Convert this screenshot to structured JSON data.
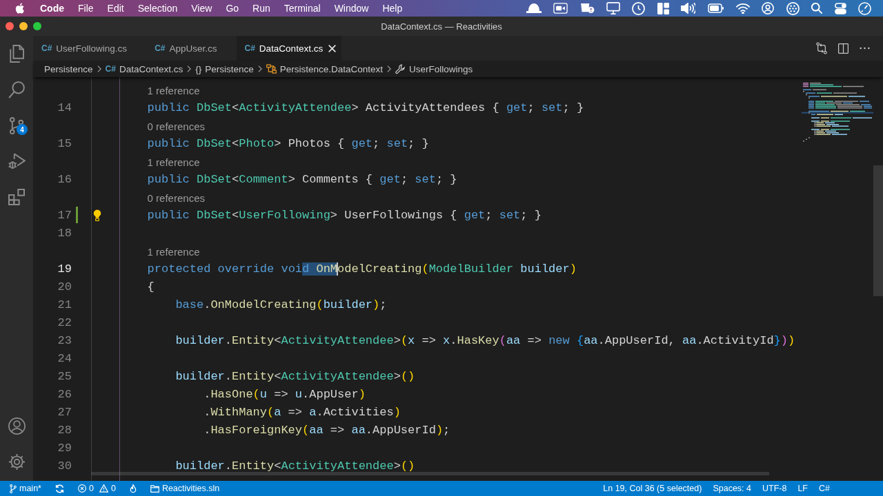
{
  "menu_bar": {
    "app_name": "Code",
    "items": [
      "File",
      "Edit",
      "Selection",
      "View",
      "Go",
      "Run",
      "Terminal",
      "Window",
      "Help"
    ]
  },
  "window": {
    "title": "DataContext.cs — Reactivities"
  },
  "activity_bar": {
    "badge": "4"
  },
  "tabs": [
    {
      "file_icon": "C#",
      "label": "UserFollowing.cs",
      "selected": false
    },
    {
      "file_icon": "C#",
      "label": "AppUser.cs",
      "selected": false
    },
    {
      "file_icon": "C#",
      "label": "DataContext.cs",
      "selected": true
    }
  ],
  "breadcrumb": [
    {
      "kind": "folder",
      "label": "Persistence"
    },
    {
      "kind": "file",
      "icon_text": "C#",
      "label": "DataContext.cs"
    },
    {
      "kind": "namespace",
      "icon_text": "{}",
      "label": "Persistence"
    },
    {
      "kind": "class",
      "label": "Persistence.DataContext"
    },
    {
      "kind": "property",
      "label": "UserFollowings"
    }
  ],
  "editor": {
    "lines": [
      {
        "number": "14",
        "code_lens": "1 reference",
        "current": false,
        "added": false,
        "lightbulb": false,
        "tokens": [
          {
            "text": "        public ",
            "kind": "keyword"
          },
          {
            "text": "DbSet",
            "kind": "type"
          },
          {
            "text": "<",
            "kind": "plain"
          },
          {
            "text": "ActivityAttendee",
            "kind": "type"
          },
          {
            "text": "> ActivityAttendees { ",
            "kind": "plain"
          },
          {
            "text": "get",
            "kind": "keyword"
          },
          {
            "text": "; ",
            "kind": "plain"
          },
          {
            "text": "set",
            "kind": "keyword"
          },
          {
            "text": "; }",
            "kind": "plain"
          }
        ]
      },
      {
        "number": "15",
        "code_lens": "0 references",
        "current": false,
        "added": false,
        "lightbulb": false,
        "tokens": [
          {
            "text": "        public ",
            "kind": "keyword"
          },
          {
            "text": "DbSet",
            "kind": "type"
          },
          {
            "text": "<",
            "kind": "plain"
          },
          {
            "text": "Photo",
            "kind": "type"
          },
          {
            "text": "> Photos { ",
            "kind": "plain"
          },
          {
            "text": "get",
            "kind": "keyword"
          },
          {
            "text": "; ",
            "kind": "plain"
          },
          {
            "text": "set",
            "kind": "keyword"
          },
          {
            "text": "; }",
            "kind": "plain"
          }
        ]
      },
      {
        "number": "16",
        "code_lens": "1 reference",
        "current": false,
        "added": false,
        "lightbulb": false,
        "tokens": [
          {
            "text": "        public ",
            "kind": "keyword"
          },
          {
            "text": "DbSet",
            "kind": "type"
          },
          {
            "text": "<",
            "kind": "plain"
          },
          {
            "text": "Comment",
            "kind": "type"
          },
          {
            "text": "> Comments { ",
            "kind": "plain"
          },
          {
            "text": "get",
            "kind": "keyword"
          },
          {
            "text": "; ",
            "kind": "plain"
          },
          {
            "text": "set",
            "kind": "keyword"
          },
          {
            "text": "; }",
            "kind": "plain"
          }
        ]
      },
      {
        "number": "17",
        "code_lens": "0 references",
        "current": false,
        "added": true,
        "lightbulb": true,
        "tokens": [
          {
            "text": "        public ",
            "kind": "keyword"
          },
          {
            "text": "DbSet",
            "kind": "type"
          },
          {
            "text": "<",
            "kind": "plain"
          },
          {
            "text": "UserFollowing",
            "kind": "type"
          },
          {
            "text": "> UserFollowings { ",
            "kind": "plain"
          },
          {
            "text": "get",
            "kind": "keyword"
          },
          {
            "text": "; ",
            "kind": "plain"
          },
          {
            "text": "set",
            "kind": "keyword"
          },
          {
            "text": "; }",
            "kind": "plain"
          }
        ]
      },
      {
        "number": "18",
        "current": false,
        "added": false,
        "lightbulb": false
      },
      {
        "number": "19",
        "code_lens": "1 reference",
        "current": true,
        "added": false,
        "lightbulb": false,
        "tokens": [
          {
            "text": "        protected override voi",
            "kind": "keyword",
            "selected": false
          },
          {
            "text": "d ",
            "kind": "keyword",
            "selected": true
          },
          {
            "text": "OnM",
            "kind": "method",
            "selected": true
          },
          {
            "text": "odelCreating",
            "kind": "method",
            "selected": false
          },
          {
            "text": "(",
            "kind": "bracket1",
            "selected": false
          },
          {
            "text": "ModelBuilder",
            "kind": "type",
            "selected": false
          },
          {
            "text": " builder",
            "kind": "variable",
            "selected": false
          },
          {
            "text": ")",
            "kind": "bracket1",
            "selected": false
          }
        ]
      },
      {
        "number": "20",
        "current": false,
        "added": false,
        "lightbulb": false,
        "tokens": [
          {
            "text": "        {",
            "kind": "plain"
          }
        ]
      },
      {
        "number": "21",
        "current": false,
        "added": false,
        "lightbulb": false,
        "tokens": [
          {
            "text": "            base",
            "kind": "keyword"
          },
          {
            "text": ".",
            "kind": "plain"
          },
          {
            "text": "OnModelCreating",
            "kind": "method"
          },
          {
            "text": "(",
            "kind": "bracket1"
          },
          {
            "text": "builder",
            "kind": "variable"
          },
          {
            "text": ")",
            "kind": "bracket1"
          },
          {
            "text": ";",
            "kind": "plain"
          }
        ]
      },
      {
        "number": "22",
        "current": false,
        "added": false,
        "lightbulb": false
      },
      {
        "number": "23",
        "current": false,
        "added": false,
        "lightbulb": false,
        "tokens": [
          {
            "text": "            builder",
            "kind": "variable"
          },
          {
            "text": ".",
            "kind": "plain"
          },
          {
            "text": "Entity",
            "kind": "method"
          },
          {
            "text": "<",
            "kind": "plain"
          },
          {
            "text": "ActivityAttendee",
            "kind": "type"
          },
          {
            "text": ">",
            "kind": "plain"
          },
          {
            "text": "(",
            "kind": "bracket1"
          },
          {
            "text": "x",
            "kind": "variable"
          },
          {
            "text": " => ",
            "kind": "plain"
          },
          {
            "text": "x",
            "kind": "variable"
          },
          {
            "text": ".",
            "kind": "plain"
          },
          {
            "text": "HasKey",
            "kind": "method"
          },
          {
            "text": "(",
            "kind": "bracket2"
          },
          {
            "text": "aa",
            "kind": "variable"
          },
          {
            "text": " => ",
            "kind": "plain"
          },
          {
            "text": "new ",
            "kind": "keyword"
          },
          {
            "text": "{",
            "kind": "bracket3"
          },
          {
            "text": "aa",
            "kind": "variable"
          },
          {
            "text": ".AppUserId, ",
            "kind": "plain"
          },
          {
            "text": "aa",
            "kind": "variable"
          },
          {
            "text": ".ActivityId",
            "kind": "plain"
          },
          {
            "text": "}",
            "kind": "bracket3"
          },
          {
            "text": ")",
            "kind": "bracket2"
          },
          {
            "text": ")",
            "kind": "bracket1"
          }
        ]
      },
      {
        "number": "24",
        "current": false,
        "added": false,
        "lightbulb": false
      },
      {
        "number": "25",
        "current": false,
        "added": false,
        "lightbulb": false,
        "tokens": [
          {
            "text": "            builder",
            "kind": "variable"
          },
          {
            "text": ".",
            "kind": "plain"
          },
          {
            "text": "Entity",
            "kind": "method"
          },
          {
            "text": "<",
            "kind": "plain"
          },
          {
            "text": "ActivityAttendee",
            "kind": "type"
          },
          {
            "text": ">",
            "kind": "plain"
          },
          {
            "text": "()",
            "kind": "bracket1"
          }
        ]
      },
      {
        "number": "26",
        "current": false,
        "added": false,
        "lightbulb": false,
        "tokens": [
          {
            "text": "                .",
            "kind": "plain"
          },
          {
            "text": "HasOne",
            "kind": "method"
          },
          {
            "text": "(",
            "kind": "bracket1"
          },
          {
            "text": "u",
            "kind": "variable"
          },
          {
            "text": " => ",
            "kind": "plain"
          },
          {
            "text": "u",
            "kind": "variable"
          },
          {
            "text": ".AppUser",
            "kind": "plain"
          },
          {
            "text": ")",
            "kind": "bracket1"
          }
        ]
      },
      {
        "number": "27",
        "current": false,
        "added": false,
        "lightbulb": false,
        "tokens": [
          {
            "text": "                .",
            "kind": "plain"
          },
          {
            "text": "WithMany",
            "kind": "method"
          },
          {
            "text": "(",
            "kind": "bracket1"
          },
          {
            "text": "a",
            "kind": "variable"
          },
          {
            "text": " => ",
            "kind": "plain"
          },
          {
            "text": "a",
            "kind": "variable"
          },
          {
            "text": ".Activities",
            "kind": "plain"
          },
          {
            "text": ")",
            "kind": "bracket1"
          }
        ]
      },
      {
        "number": "28",
        "current": false,
        "added": false,
        "lightbulb": false,
        "tokens": [
          {
            "text": "                .",
            "kind": "plain"
          },
          {
            "text": "HasForeignKey",
            "kind": "method"
          },
          {
            "text": "(",
            "kind": "bracket1"
          },
          {
            "text": "aa",
            "kind": "variable"
          },
          {
            "text": " => ",
            "kind": "plain"
          },
          {
            "text": "aa",
            "kind": "variable"
          },
          {
            "text": ".AppUserId",
            "kind": "plain"
          },
          {
            "text": ")",
            "kind": "bracket1"
          },
          {
            "text": ";",
            "kind": "plain"
          }
        ]
      },
      {
        "number": "29",
        "current": false,
        "added": false,
        "lightbulb": false
      },
      {
        "number": "30",
        "current": false,
        "added": false,
        "lightbulb": false,
        "tokens": [
          {
            "text": "            builder",
            "kind": "variable"
          },
          {
            "text": ".",
            "kind": "plain"
          },
          {
            "text": "Entity",
            "kind": "method"
          },
          {
            "text": "<",
            "kind": "plain"
          },
          {
            "text": "ActivityAttendee",
            "kind": "type"
          },
          {
            "text": ">",
            "kind": "plain"
          },
          {
            "text": "()",
            "kind": "bracket1"
          }
        ]
      }
    ]
  },
  "status_bar": {
    "branch": "main*",
    "errors": "0",
    "warnings": "0",
    "solution": "Reactivities.sln",
    "position": "Ln 19, Col 36 (5 selected)",
    "indentation": "Spaces: 4",
    "encoding": "UTF-8",
    "line_ending": "LF",
    "language": "C#"
  }
}
